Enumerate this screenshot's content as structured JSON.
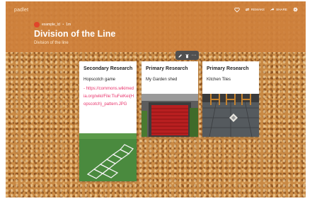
{
  "app": {
    "brand": "padlet"
  },
  "header": {
    "actions": [
      {
        "name": "heart-button",
        "label": ""
      },
      {
        "name": "remake-button",
        "label": "REMAKE"
      },
      {
        "name": "share-button",
        "label": "SHARE"
      }
    ],
    "author": "example_lcl",
    "separator": "•",
    "time": "1m",
    "title": "Division of the Line",
    "subtitle": "Division of the line"
  },
  "cards": [
    {
      "title": "Secondary Research",
      "body": "Hopscotch game",
      "link": "- https://commons.wikimedia.org/wiki/File:TiuFeiKei(Hopscotch)_pattern.JPG",
      "image": "hopscotch-image"
    },
    {
      "title": "Primary Research",
      "body": "My Garden shed",
      "image": "garden-shed-image"
    },
    {
      "title": "Primary Research",
      "body": "Kitchen Tiles",
      "image": "kitchen-tiles-image"
    }
  ],
  "toolbar": {
    "more_label": "···"
  },
  "colors": {
    "header": "#ce803c",
    "accent_link": "#e8336b",
    "board": "#c98a45"
  }
}
